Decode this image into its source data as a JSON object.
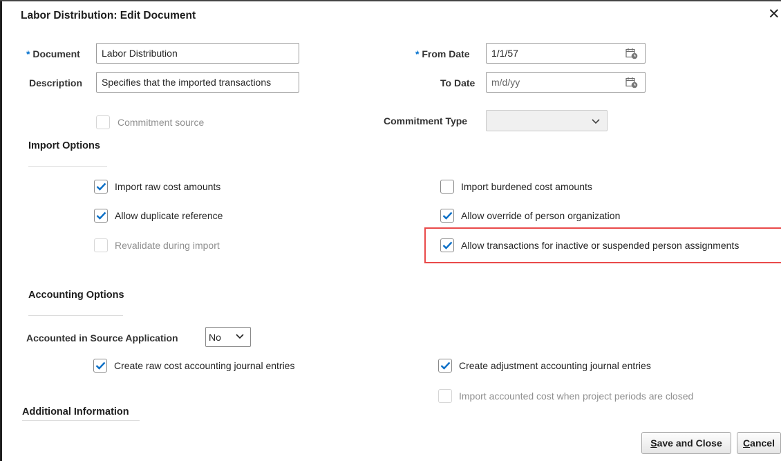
{
  "dialog": {
    "title": "Labor Distribution: Edit Document",
    "close_icon": "close-icon"
  },
  "form": {
    "required_marker": "*",
    "document": {
      "label": "Document",
      "value": "Labor Distribution"
    },
    "description": {
      "label": "Description",
      "value": "Specifies that the imported transactions"
    },
    "from_date": {
      "label": "From Date",
      "value": "1/1/57",
      "icon": "calendar-icon"
    },
    "to_date": {
      "label": "To Date",
      "placeholder": "m/d/yy",
      "icon": "calendar-icon"
    },
    "commitment_source": {
      "label": "Commitment source",
      "checked": false,
      "disabled": true
    },
    "commitment_type": {
      "label": "Commitment Type",
      "value": "",
      "icon": "chevron-down-icon"
    }
  },
  "import_options": {
    "title": "Import Options",
    "import_raw_cost": {
      "label": "Import raw cost amounts",
      "checked": true
    },
    "import_burdened_cost": {
      "label": "Import burdened cost amounts",
      "checked": false
    },
    "allow_duplicate_reference": {
      "label": "Allow duplicate reference",
      "checked": true
    },
    "allow_override_person_org": {
      "label": "Allow override of person organization",
      "checked": true
    },
    "revalidate_during_import": {
      "label": "Revalidate during import",
      "checked": false,
      "disabled": true
    },
    "allow_inactive_assignments": {
      "label": "Allow transactions for inactive or suspended person assignments",
      "checked": true
    }
  },
  "accounting_options": {
    "title": "Accounting Options",
    "accounted_in_source": {
      "label": "Accounted in Source Application",
      "value": "No",
      "icon": "chevron-down-icon"
    },
    "create_raw_cost_journal": {
      "label": "Create raw cost accounting journal entries",
      "checked": true
    },
    "create_adjustment_journal": {
      "label": "Create adjustment accounting journal entries",
      "checked": true
    },
    "import_accounted_cost_closed": {
      "label": "Import accounted cost when project periods are closed",
      "checked": false,
      "disabled": true
    }
  },
  "additional_information": {
    "title": "Additional Information"
  },
  "buttons": {
    "save_and_close": {
      "mnemonic": "S",
      "rest": "ave and Close"
    },
    "cancel": {
      "mnemonic": "C",
      "rest": "ancel"
    }
  },
  "colors": {
    "highlight_border": "#e94a4a",
    "checkmark": "#0a6ec6",
    "required": "#0572ce"
  }
}
